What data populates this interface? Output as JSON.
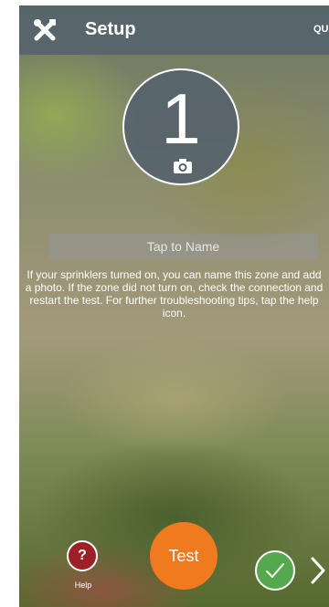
{
  "header": {
    "title": "Setup",
    "right_label": "QUI",
    "tools_icon": "tools-icon"
  },
  "zone": {
    "number": "1",
    "camera_icon": "camera-icon"
  },
  "name_field": {
    "placeholder": "Tap to Name",
    "value": ""
  },
  "info_text": "If your sprinklers turned on, you can name this zone and add a photo. If the zone did not turn on, check the connection and restart the test. For further troubleshooting tips, tap the help icon.",
  "footer": {
    "help_symbol": "?",
    "help_label": "Help",
    "test_label": "Test",
    "check_icon": "check-icon",
    "next_icon": "chevron-right-icon"
  },
  "colors": {
    "topbar": "#54626c",
    "help": "#9c2026",
    "test": "#f07a1e",
    "check": "#55a84b"
  }
}
